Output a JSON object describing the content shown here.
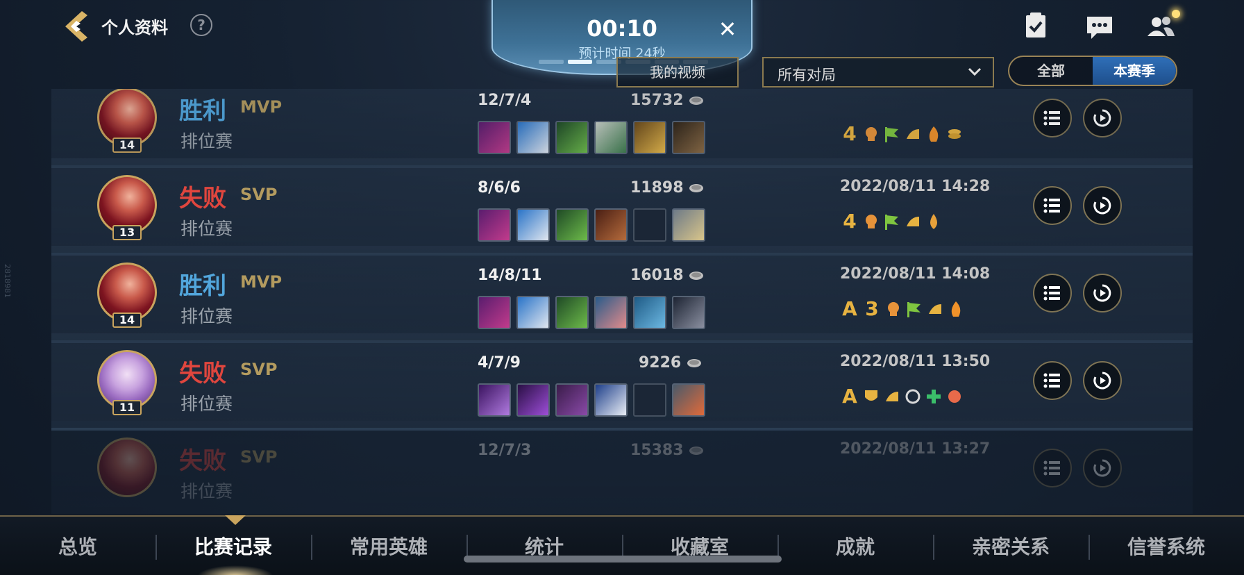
{
  "header": {
    "title": "个人资料",
    "help_label": "?",
    "icons": [
      "task-icon",
      "chat-icon",
      "friends-icon"
    ]
  },
  "timer": {
    "time": "00:10",
    "subtitle": "预计时间 24秒",
    "close_label": "✕"
  },
  "filters": {
    "video_button": "我的视频",
    "dropdown_value": "所有对局",
    "scope_options": [
      "全部",
      "本赛季"
    ],
    "scope_selected": "本赛季"
  },
  "matches": [
    {
      "result": "胜利",
      "result_type": "win",
      "badge": "MVP",
      "mode": "排位赛",
      "level": "14",
      "kda": "12/7/4",
      "gold": "15732",
      "date": "",
      "hero": "red",
      "items": [
        "purple",
        "blue",
        "green",
        "mask",
        "gold",
        "boots"
      ],
      "honors": [
        "4",
        "skull",
        "flag",
        "shoe",
        "fire",
        "coins"
      ]
    },
    {
      "result": "失败",
      "result_type": "loss",
      "badge": "SVP",
      "mode": "排位赛",
      "level": "13",
      "kda": "8/6/6",
      "gold": "11898",
      "date": "2022/08/11 14:28",
      "hero": "red",
      "items": [
        "purple",
        "blue",
        "green",
        "book",
        "empty",
        "armor"
      ],
      "honors": [
        "4",
        "skull",
        "flag",
        "shoe",
        "drop"
      ]
    },
    {
      "result": "胜利",
      "result_type": "win",
      "badge": "MVP",
      "mode": "排位赛",
      "level": "14",
      "kda": "14/8/11",
      "gold": "16018",
      "date": "2022/08/11 14:08",
      "hero": "red",
      "items": [
        "purple",
        "blue",
        "green",
        "dragon",
        "mail",
        "gem"
      ],
      "honors": [
        "A",
        "3",
        "skull",
        "flag",
        "shoe",
        "fire"
      ]
    },
    {
      "result": "失败",
      "result_type": "loss",
      "badge": "SVP",
      "mode": "排位赛",
      "level": "11",
      "kda": "4/7/9",
      "gold": "9226",
      "date": "2022/08/11 13:50",
      "hero": "purple",
      "items": [
        "staff",
        "orb",
        "tome",
        "cape",
        "empty",
        "feather"
      ],
      "honors": [
        "A",
        "shield",
        "shoe",
        "skill",
        "heal",
        "flower"
      ]
    },
    {
      "result": "失败",
      "result_type": "loss",
      "badge": "SVP",
      "mode": "排位赛",
      "level": "",
      "kda": "12/7/3",
      "gold": "15383",
      "date": "2022/08/11 13:27",
      "hero": "red",
      "items": [],
      "honors": []
    }
  ],
  "nav": {
    "tabs": [
      "总览",
      "比赛记录",
      "常用英雄",
      "统计",
      "收藏室",
      "成就",
      "亲密关系",
      "信誉系统"
    ],
    "active": "比赛记录"
  },
  "side_text": "2818981",
  "colors": {
    "win": "#52a6dc",
    "loss": "#e0463e",
    "gold_accent": "#c9a45e",
    "honor": "#e7b341",
    "active_tab": "#2f6fb8"
  }
}
